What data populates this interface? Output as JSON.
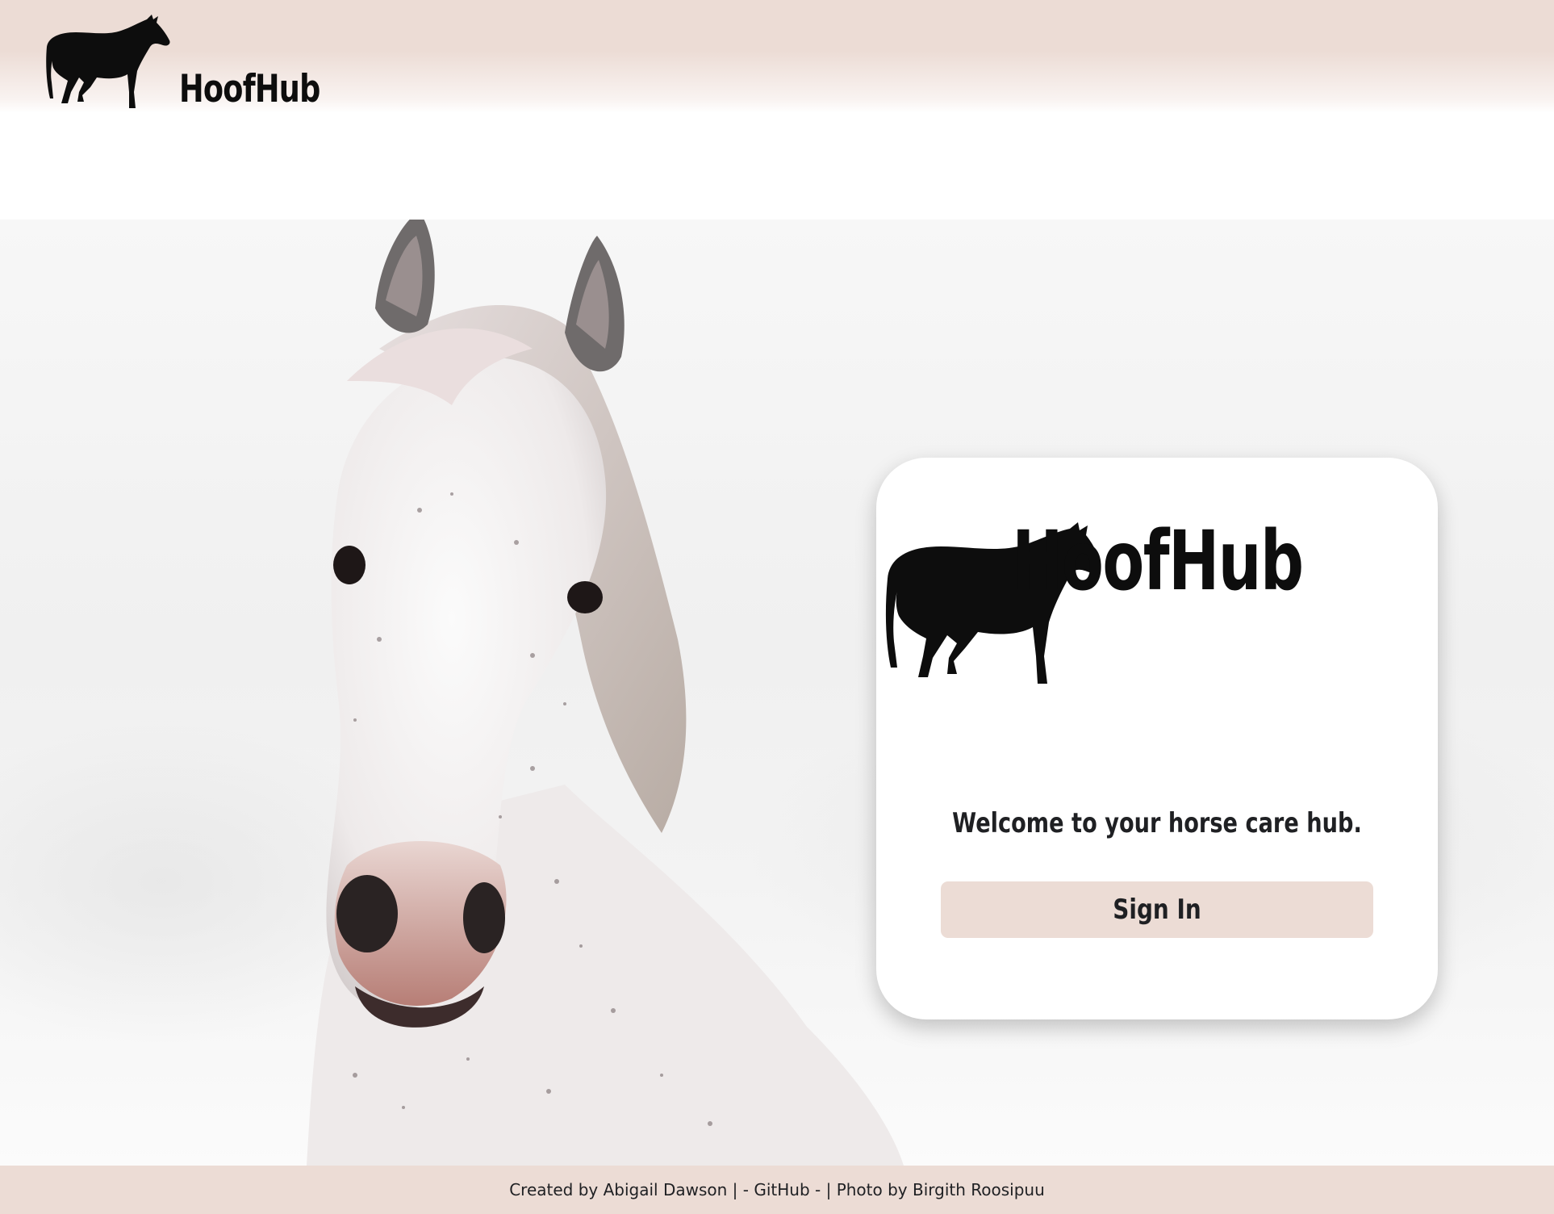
{
  "header": {
    "logo_text": "HoofHub",
    "logo_icon": "horse-silhouette-icon"
  },
  "hero": {
    "image": "white-horse-photo"
  },
  "card": {
    "logo_text": "HoofHub",
    "logo_icon": "horse-silhouette-icon",
    "tagline": "Welcome to your horse care hub.",
    "sign_in_label": "Sign In"
  },
  "footer": {
    "created_by": "Created by Abigail Dawson | - ",
    "github_link": "GitHub",
    "separator": " - | ",
    "photo_credit": "Photo by Birgith Roosipuu"
  },
  "colors": {
    "brand_bg": "#ecdcd5",
    "text": "#1f2023",
    "logo": "#0d0d0d"
  }
}
